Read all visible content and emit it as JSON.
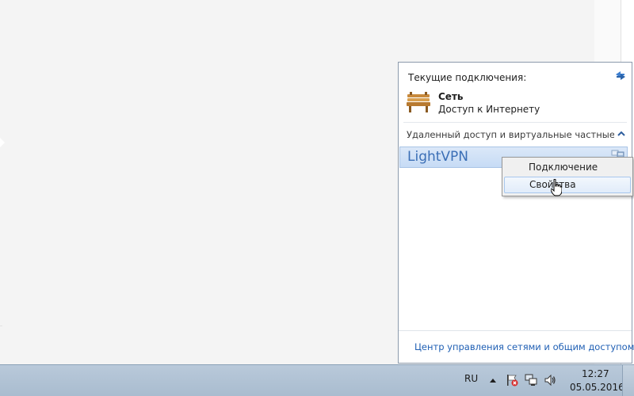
{
  "flyout": {
    "current_connections_label": "Текущие подключения:",
    "network": {
      "name": "Сеть",
      "status": "Доступ к Интернету",
      "icon": "bench-network-icon"
    },
    "section_label": "Удаленный доступ и виртуальные частные се...",
    "vpn_connection": "LightVPN",
    "footer_link": "Центр управления сетями и общим доступом"
  },
  "context_menu": {
    "items": [
      "Подключение",
      "Свойства"
    ],
    "hovered_index": 1
  },
  "taskbar": {
    "language": "RU",
    "time": "12:27",
    "date": "05.05.2016",
    "tray_icons": [
      "show-hidden-icons-arrow",
      "action-center-flag-icon",
      "network-icon",
      "volume-icon"
    ]
  },
  "colors": {
    "link": "#1f5fb4",
    "vpn_text": "#3b6fb6",
    "selection_bg": "#c6dbf5",
    "taskbar": "#b1c3d5"
  }
}
